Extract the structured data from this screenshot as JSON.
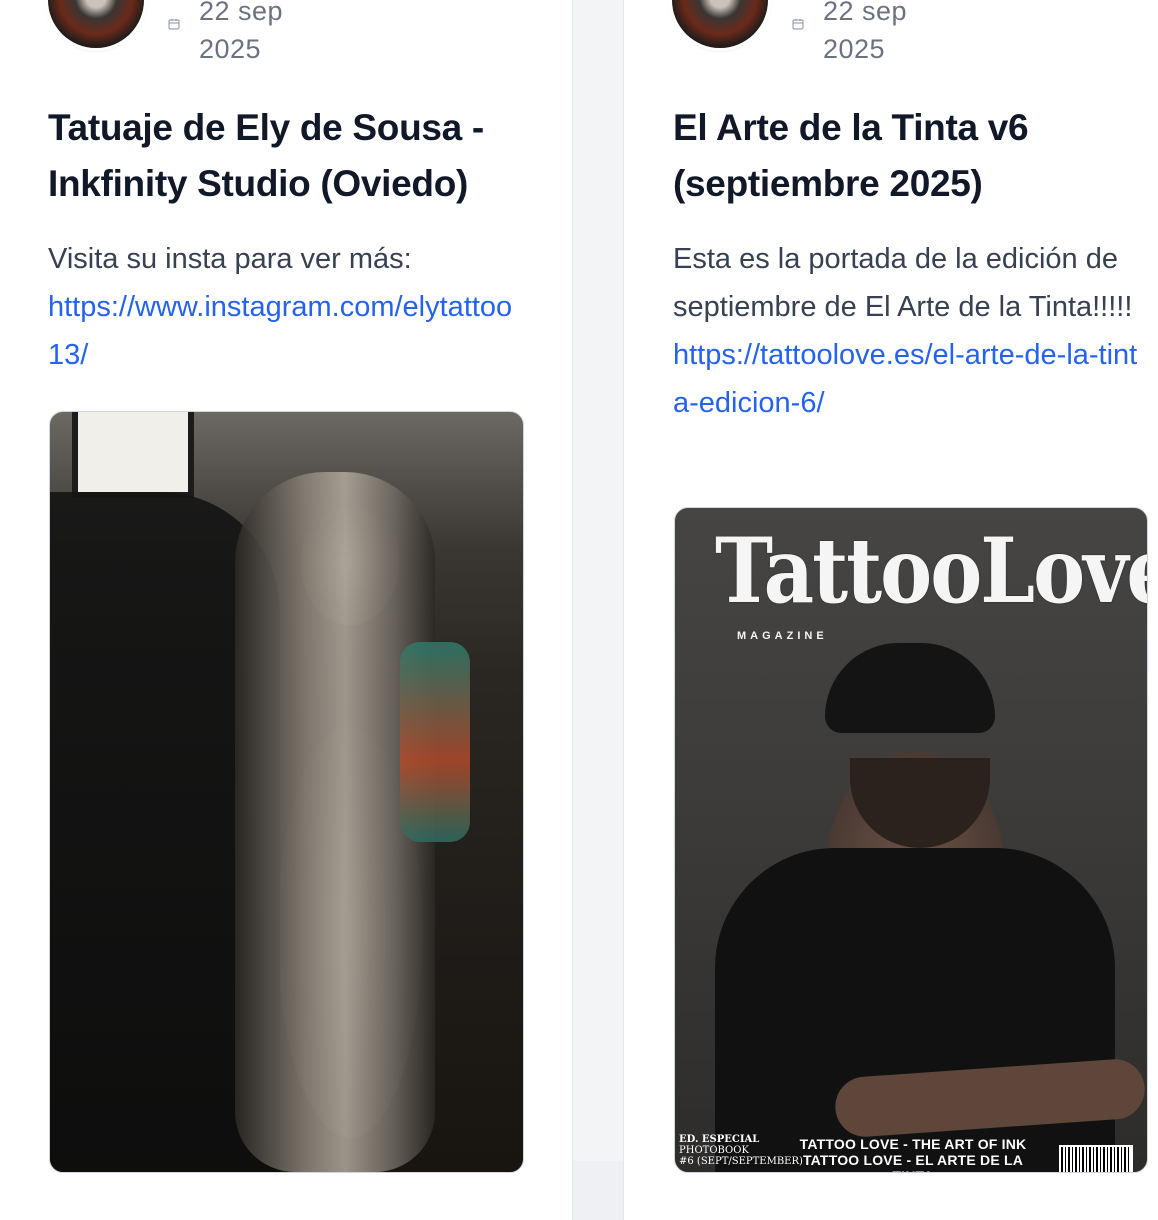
{
  "posts": [
    {
      "date": "22 sep\n2025",
      "title": "Tatuaje de Ely de Sousa - Inkfinity Studio (Oviedo)",
      "body": "Visita su insta para ver más:",
      "link": "https://www.instagram.com/elytattoo13/",
      "image_description": "tattoo-sleeve-photo"
    },
    {
      "date": "22 sep\n2025",
      "title": "El Arte de la Tinta v6 (septiembre 2025)",
      "body": "Esta es la portada de la edición de septiembre de El Arte de la Tinta!!!!!",
      "link": "https://tattoolove.es/el-arte-de-la-tinta-edicion-6/",
      "cover": {
        "logo": "TattooLove",
        "subtitle": "MAGAZINE",
        "edition_label": "ED. ESPECIAL",
        "edition_sub": "PHOTOBOOK",
        "edition_num": "#6 (SEPT/SEPTEMBER)",
        "headline_1": "TATTOO LOVE - THE ART OF INK",
        "headline_2": "TATTOO LOVE - EL ARTE DE LA TINTA"
      }
    }
  ],
  "colors": {
    "link": "#2563eb",
    "title": "#111827",
    "text": "#374151",
    "muted": "#6b7280"
  },
  "icons": [
    "calendar-icon"
  ]
}
